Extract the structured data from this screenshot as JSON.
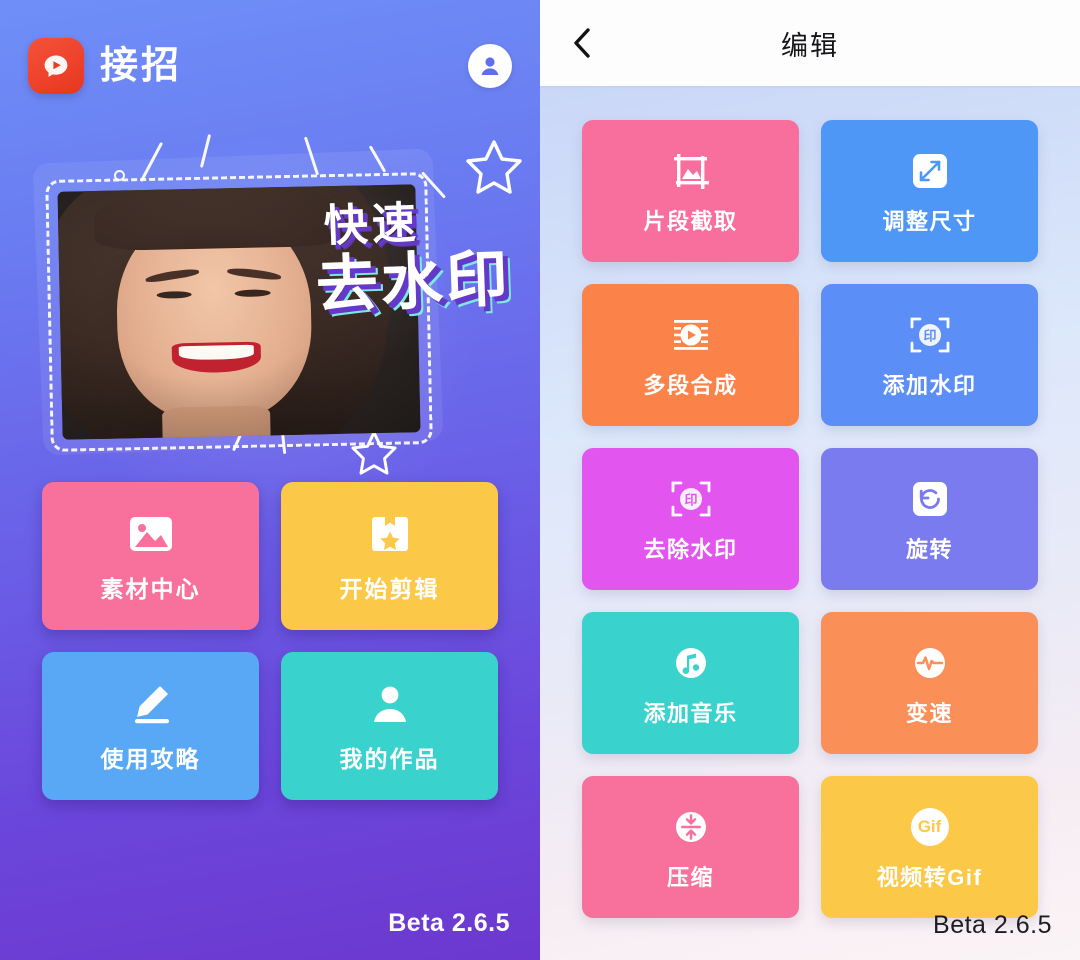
{
  "home": {
    "app_name": "接招",
    "logo_icon": "play-bubble-icon",
    "avatar_icon": "user-avatar-icon",
    "banner": {
      "headline_small": "快速",
      "headline_large": "去水印",
      "photo_alt": "smiling-woman-photo",
      "decor_icons": [
        "star-outline-icon",
        "star-outline-icon",
        "sparkle-line-icon"
      ]
    },
    "cards": [
      {
        "label": "素材中心",
        "color": "#f8719d",
        "icon": "image-icon"
      },
      {
        "label": "开始剪辑",
        "color": "#fbc847",
        "icon": "bookmark-star-icon"
      },
      {
        "label": "使用攻略",
        "color": "#58a8f5",
        "icon": "pencil-icon"
      },
      {
        "label": "我的作品",
        "color": "#3ad2cc",
        "icon": "person-icon"
      }
    ],
    "version": "Beta 2.6.5"
  },
  "edit": {
    "back_icon": "chevron-left-icon",
    "title": "编辑",
    "cards": [
      {
        "label": "片段截取",
        "color": "#f86f9d",
        "icon": "crop-frame-icon"
      },
      {
        "label": "调整尺寸",
        "color": "#4e97f7",
        "icon": "resize-arrows-icon"
      },
      {
        "label": "多段合成",
        "color": "#fb8349",
        "icon": "video-merge-icon"
      },
      {
        "label": "添加水印",
        "color": "#5c8ef8",
        "icon": "add-watermark-icon"
      },
      {
        "label": "去除水印",
        "color": "#e355ef",
        "icon": "remove-watermark-icon"
      },
      {
        "label": "旋转",
        "color": "#7b7bf0",
        "icon": "rotate-icon"
      },
      {
        "label": "添加音乐",
        "color": "#3ad2cc",
        "icon": "music-note-icon"
      },
      {
        "label": "变速",
        "color": "#fb8f58",
        "icon": "speed-pulse-icon"
      },
      {
        "label": "压缩",
        "color": "#f8719d",
        "icon": "compress-icon"
      },
      {
        "label": "视频转Gif",
        "color": "#fbc847",
        "icon": "gif-badge-icon",
        "badge_text": "Gif"
      }
    ],
    "version": "Beta 2.6.5"
  }
}
